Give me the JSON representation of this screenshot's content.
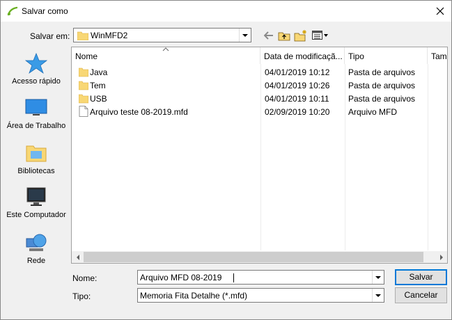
{
  "window": {
    "title": "Salvar como"
  },
  "location": {
    "label": "Salvar em:",
    "value": "WinMFD2"
  },
  "places": [
    {
      "label": "Acesso rápido"
    },
    {
      "label": "Área de Trabalho"
    },
    {
      "label": "Bibliotecas"
    },
    {
      "label": "Este Computador"
    },
    {
      "label": "Rede"
    }
  ],
  "columns": {
    "name": "Nome",
    "date": "Data de modificaçã...",
    "type": "Tipo",
    "size": "Tam"
  },
  "files": [
    {
      "name": "Java",
      "date": "04/01/2019 10:12",
      "type": "Pasta de arquivos",
      "kind": "folder"
    },
    {
      "name": "Tem",
      "date": "04/01/2019 10:26",
      "type": "Pasta de arquivos",
      "kind": "folder"
    },
    {
      "name": "USB",
      "date": "04/01/2019 10:11",
      "type": "Pasta de arquivos",
      "kind": "folder"
    },
    {
      "name": "Arquivo teste 08-2019.mfd",
      "date": "02/09/2019 10:20",
      "type": "Arquivo MFD",
      "kind": "file"
    }
  ],
  "filename": {
    "label": "Nome:",
    "value": "Arquivo MFD 08-2019"
  },
  "filetype": {
    "label": "Tipo:",
    "value": "Memoria Fita Detalhe (*.mfd)"
  },
  "buttons": {
    "save": "Salvar",
    "cancel": "Cancelar"
  },
  "colors": {
    "folder": "#f8d775",
    "accent": "#0078d7"
  }
}
